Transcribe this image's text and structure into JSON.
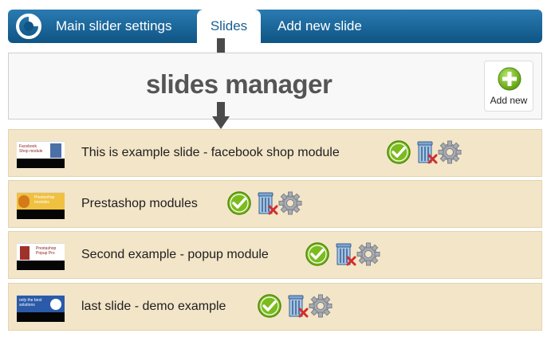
{
  "nav": {
    "tabs": [
      {
        "label": "Main slider settings"
      },
      {
        "label": "Slides"
      },
      {
        "label": "Add new slide"
      }
    ],
    "active_tab": "Slides"
  },
  "manager": {
    "title": "slides manager",
    "add_new_label": "Add new"
  },
  "slides": [
    {
      "title": "This is example slide - facebook shop module",
      "thumb_text": "Facebook Shop module",
      "thumb_bg": "#ffffff"
    },
    {
      "title": "Prestashop modules",
      "thumb_text": "Prestashop modules",
      "thumb_bg": "#f0c040"
    },
    {
      "title": "Second example - popup module",
      "thumb_text": "Prestashop Popup Pro",
      "thumb_bg": "#ffffff"
    },
    {
      "title": "last slide - demo example",
      "thumb_text": "only the best solutions",
      "thumb_bg": "#2a5aa8"
    }
  ],
  "colors": {
    "accent": "#1a5f91",
    "row_bg": "#f3e5c8",
    "enable": "#7cbb1e"
  },
  "icons": {
    "enable": "check-circle-icon",
    "delete": "trash-delete-icon",
    "settings": "gear-icon",
    "add": "plus-circle-icon"
  }
}
